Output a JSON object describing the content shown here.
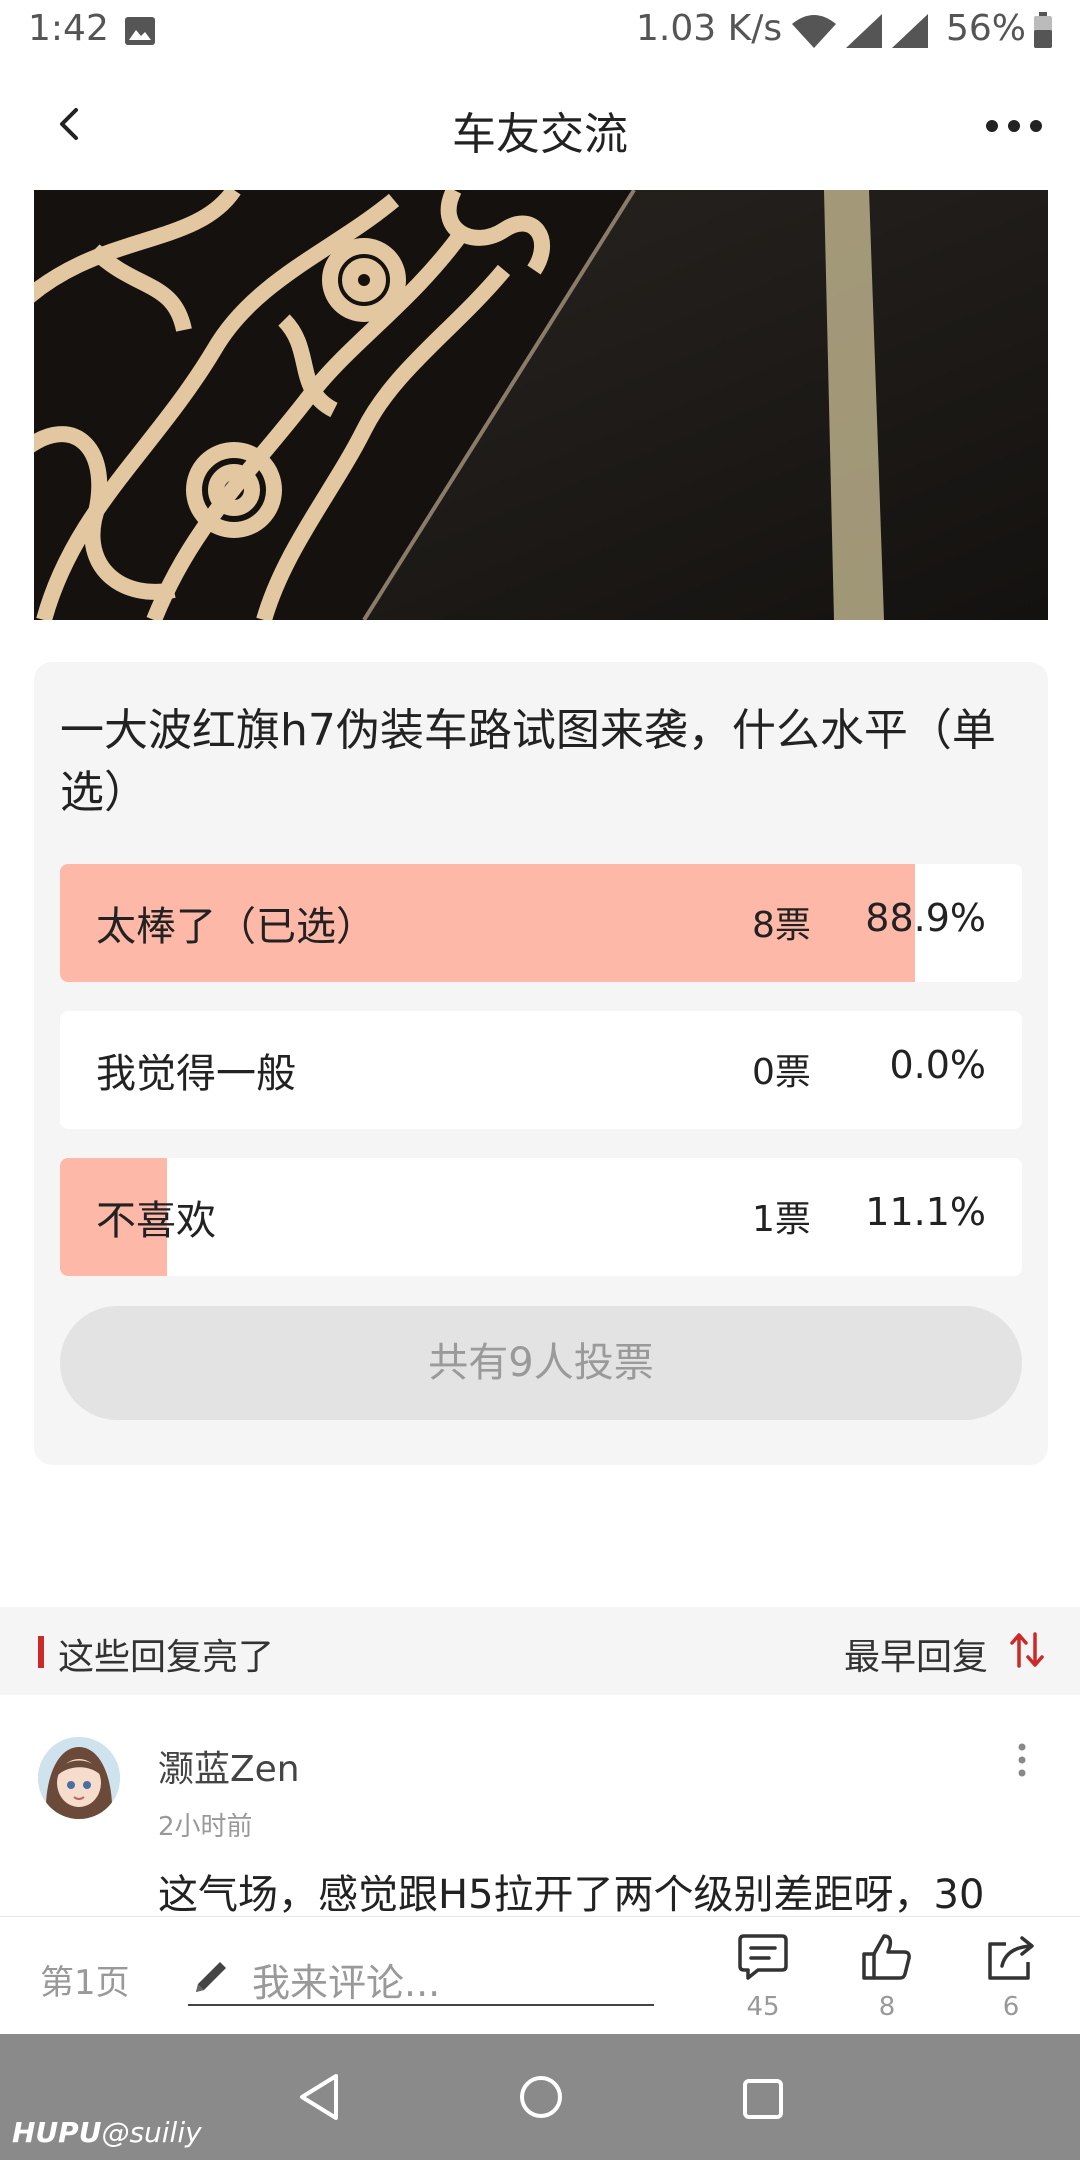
{
  "status_bar": {
    "time": "1:42",
    "net_speed": "1.03 K/s",
    "battery": "56%"
  },
  "header": {
    "title": "车友交流"
  },
  "poll": {
    "question": "一大波红旗h7伪装车路试图来袭，什么水平（单选）",
    "options": [
      {
        "label": "太棒了（已选）",
        "votes": "8票",
        "percent": "88.9%",
        "fraction": 0.889
      },
      {
        "label": "我觉得一般",
        "votes": "0票",
        "percent": "0.0%",
        "fraction": 0.0
      },
      {
        "label": "不喜欢",
        "votes": "1票",
        "percent": "11.1%",
        "fraction": 0.111
      }
    ],
    "total_label": "共有9人投票"
  },
  "replies": {
    "section_title": "这些回复亮了",
    "sort_label": "最早回复"
  },
  "comment": {
    "username": "灏蓝Zen",
    "time": "2小时前",
    "text": "这气场，感觉跟H5拉开了两个级别差距呀，30"
  },
  "bottom_bar": {
    "page_label": "第1页",
    "input_placeholder": "我来评论...",
    "comment_count": "45",
    "like_count": "8",
    "share_count": "6"
  },
  "watermark": {
    "brand": "HUPU",
    "handle": "@suiliy"
  },
  "colors": {
    "accent_red": "#cc2a2a",
    "poll_fill": "#feb8a7",
    "card_bg": "#f5f5f5"
  },
  "icons": {
    "back": "chevron-left-icon",
    "more": "more-horizontal-icon",
    "sort": "sort-arrows-icon",
    "comment": "comment-bubble-icon",
    "like": "thumbs-up-icon",
    "share": "share-icon"
  }
}
